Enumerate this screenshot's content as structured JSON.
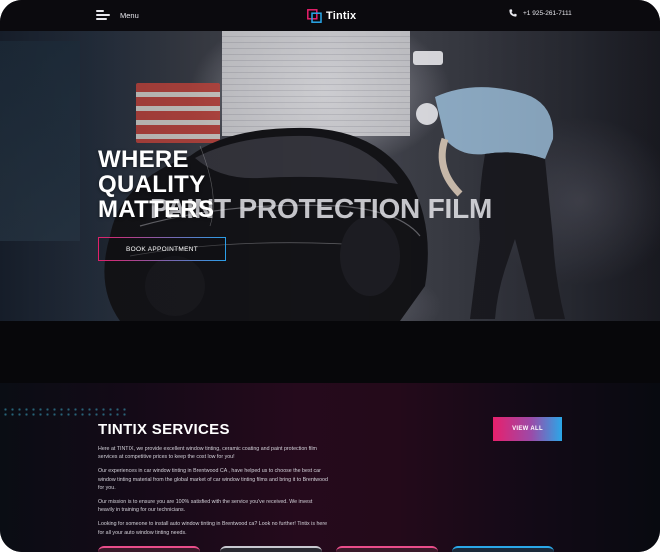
{
  "header": {
    "menu_label": "Menu",
    "logo_text": "Tintix",
    "phone": "+1 925-261-7111"
  },
  "hero": {
    "title_lines": [
      "WHERE",
      "QUALITY",
      "MATTERS"
    ],
    "overlay_text": "PAINT PROTECTION FILM",
    "cta_label": "BOOK APPOINTMENT"
  },
  "services": {
    "title": "TINTIX SERVICES",
    "paragraphs": [
      "Here at TINTIX, we provide excellent window tinting, ceramic coating and paint protection film services at competitive prices to keep the cost low for you!",
      "Our experiences in car window tinting in Brentwood CA , have helped us to choose the best car window tinting material from the global market of car window tinting films and bring it to Brentwood for you.",
      "Our mission is to ensure you are 100% satisfied with the service you've received. We invest heavily in training for our technicians.",
      "Looking for someone to install auto window tinting in Brentwood ca? Look no further! Tintix is here for all your auto window tinting needs."
    ],
    "view_all_label": "VIEW ALL"
  },
  "colors": {
    "accent_pink": "#e8206c",
    "accent_blue": "#2aa7e8",
    "background": "#0a0a0d"
  }
}
